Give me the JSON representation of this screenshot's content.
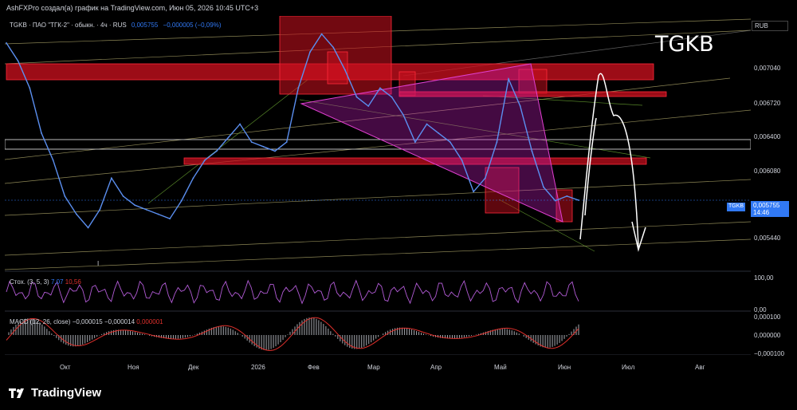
{
  "header": {
    "caption": "AshFXPro создал(а) график на TradingView.com, Июн 05, 2026 10:45 UTC+3"
  },
  "legend": {
    "symbol": "TGKB · ПАО \"ТГК-2\" · обыкн. · 4ч · RUS",
    "price": "0,005755",
    "change": "−0,000005 (−0,09%)"
  },
  "ticker_label": "TGKB",
  "currency": "RUB",
  "last_price": {
    "symbol": "TGKB",
    "value": "0,005755",
    "countdown": "14:46"
  },
  "stoch": {
    "label": "Стох. (3, 5, 3)",
    "k": "7,07",
    "d": "10,56"
  },
  "macd": {
    "label": "MACD (12, 26, close)",
    "hist": "−0,000015",
    "macd": "−0,000014",
    "signal": "0,000001"
  },
  "marker_label": "I",
  "footer": {
    "brand": "TradingView"
  },
  "chart_data": [
    {
      "type": "line",
      "series": [
        {
          "values": [
            0.0075,
            0.0073,
            0.007,
            0.0065,
            0.0062,
            0.0058,
            0.0056,
            0.00545,
            0.00565,
            0.006,
            0.0058,
            0.0057,
            0.00565,
            0.0056,
            0.00555,
            0.00575,
            0.006,
            0.0062,
            0.0063,
            0.00645,
            0.0066,
            0.0064,
            0.00635,
            0.0063,
            0.0064,
            0.007,
            0.0074,
            0.0076,
            0.00745,
            0.0072,
            0.0069,
            0.0068,
            0.007,
            0.0069,
            0.0067,
            0.0064,
            0.0066,
            0.0065,
            0.0064,
            0.0062,
            0.00585,
            0.006,
            0.0064,
            0.0071,
            0.0068,
            0.0063,
            0.0059,
            0.00575,
            0.0058,
            0.005755
          ]
        }
      ],
      "y_ticks": [
        "0,007040",
        "0,006720",
        "0,006400",
        "0,006080",
        "0,005440"
      ],
      "x_ticks": [
        "Окт",
        "Ноя",
        "Дек",
        "2026",
        "Фев",
        "Мар",
        "Апр",
        "Май",
        "Июн",
        "Июл",
        "Авг"
      ],
      "ylim": [
        0.0051,
        0.0078
      ],
      "grid": false
    },
    {
      "type": "line",
      "y_ticks": [
        "100,00",
        "0,00"
      ]
    },
    {
      "type": "bar",
      "y_ticks": [
        "0,000100",
        "0,000000",
        "−0,000100"
      ]
    }
  ],
  "colors": {
    "price_line": "#5b8ff0",
    "zone_red": "#d0101f",
    "triangle": "#c21dbd",
    "stoch_k": "#b25bd6",
    "macd_line": "#e0302c",
    "macd_hist": "#a7aab1",
    "accent": "#3179f5"
  }
}
